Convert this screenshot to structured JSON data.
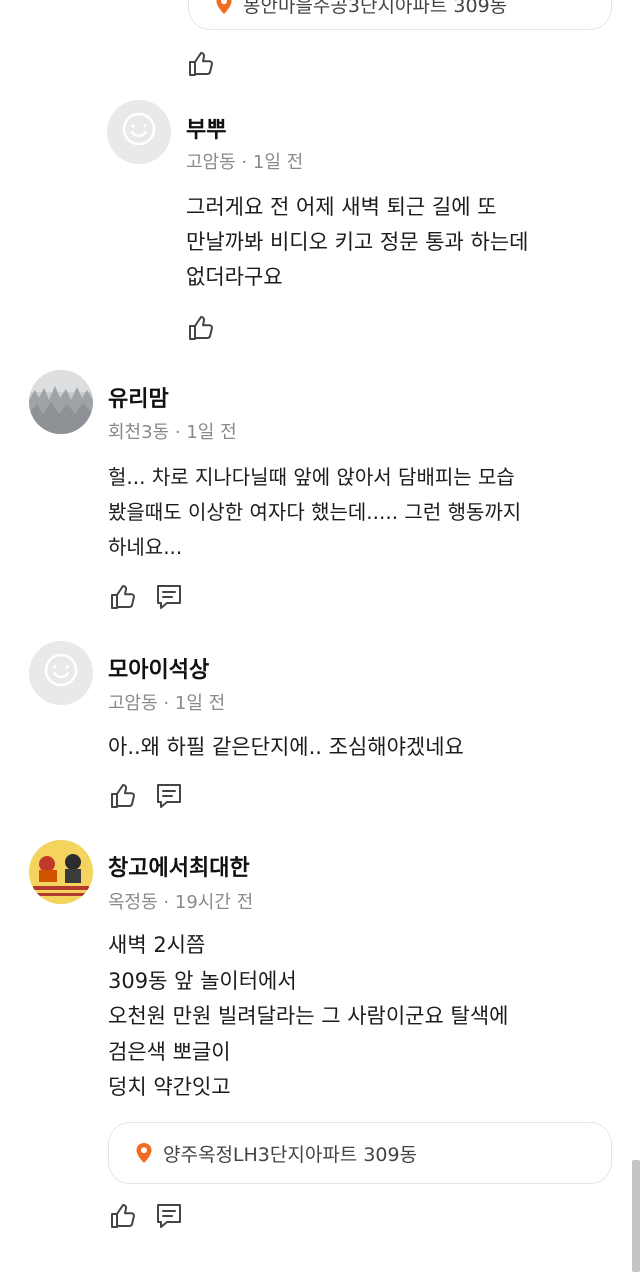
{
  "top_location": {
    "text": "봉안마을주공3단지아파트 309동"
  },
  "comments": [
    {
      "author": "부뿌",
      "neighborhood": "고암동",
      "time": "1일 전",
      "text": "그러게요 전 어제 새벽 퇴근 길에 또\n만날까봐 비디오 키고 정문 통과 하는데\n없더라구요"
    },
    {
      "author": "유리맘",
      "neighborhood": "회천3동",
      "time": "1일 전",
      "text": "헐... 차로 지나다닐때 앞에 앉아서 담배피는 모습\n봤을때도 이상한 여자다 했는데..... 그런 행동까지\n하네요..."
    },
    {
      "author": "모아이석상",
      "neighborhood": "고암동",
      "time": "1일 전",
      "text": "아..왜 하필 같은단지에.. 조심해야겠네요"
    },
    {
      "author": "창고에서최대한",
      "neighborhood": "옥정동",
      "time": "19시간 전",
      "text": "새벽 2시쯤\n309동 앞 놀이터에서\n오천원 만원 빌려달라는 그 사람이군요 탈색에\n검은색 뽀글이\n덩치 약간잇고",
      "location": "양주옥정LH3단지아파트 309동"
    }
  ],
  "separator": "·",
  "colors": {
    "pin": "#f26b21",
    "icon_stroke": "#444444",
    "meta": "#8a8a8a"
  },
  "icons": {
    "like": "thumbs-up-icon",
    "reply": "comment-icon",
    "pin": "location-pin-icon"
  }
}
